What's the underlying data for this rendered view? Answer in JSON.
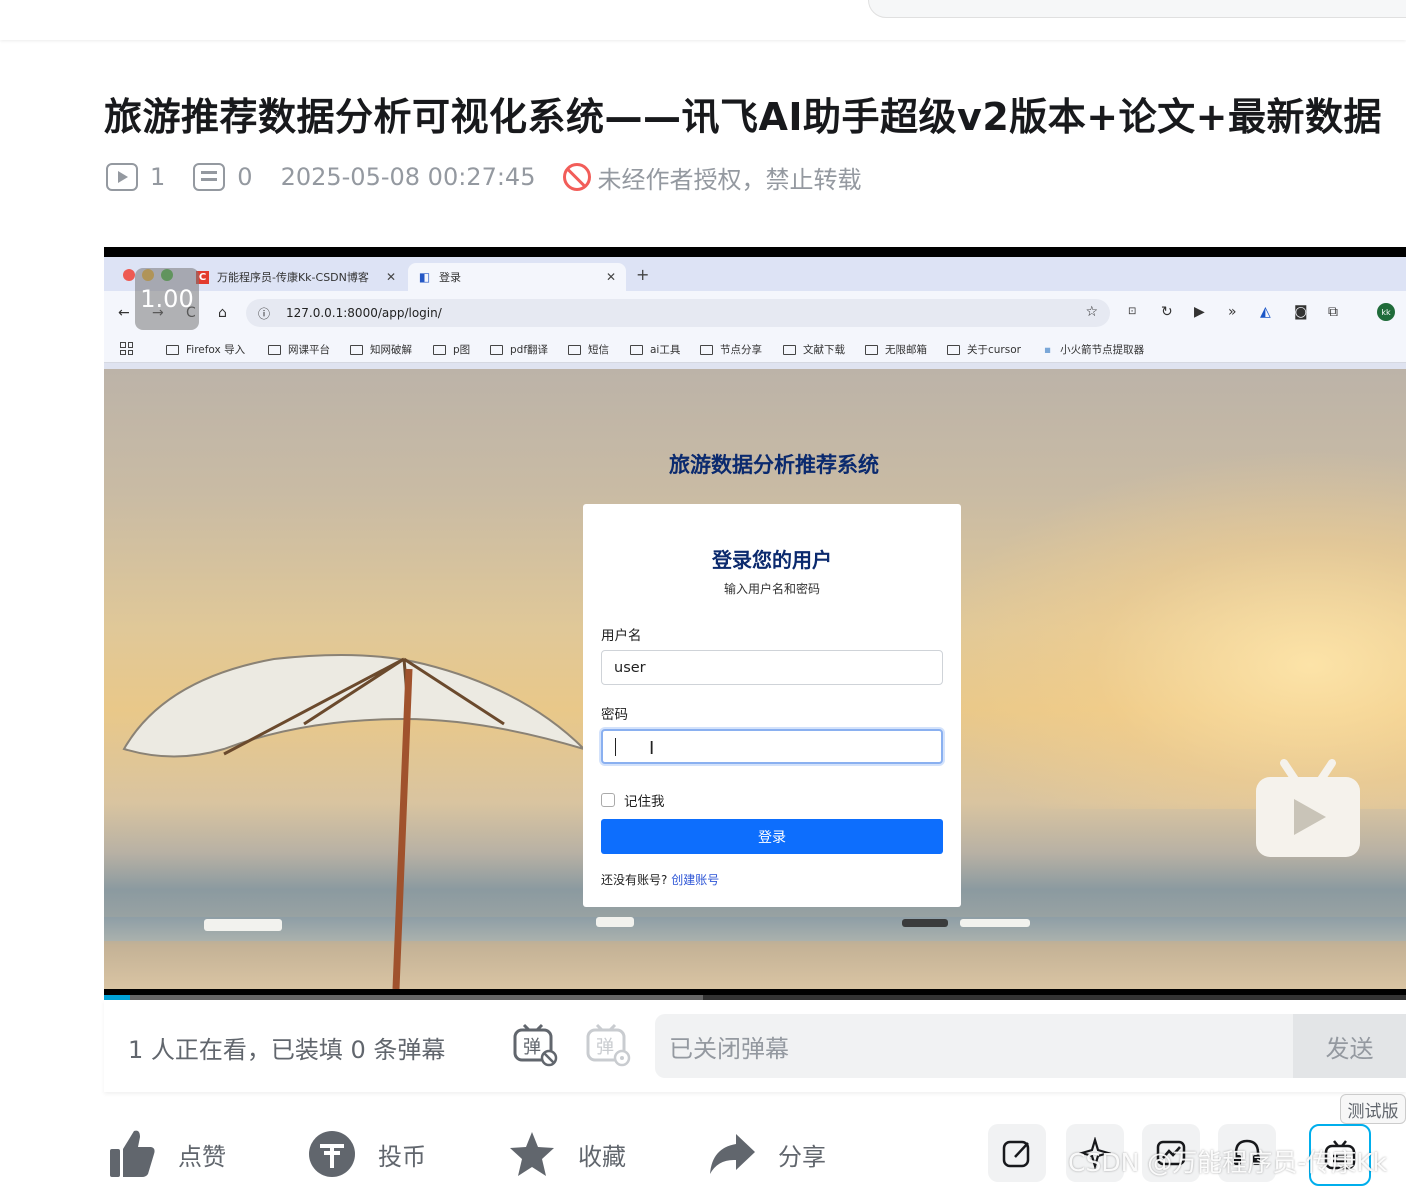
{
  "page": {
    "title": "旅游推荐数据分析可视化系统——讯飞AI助手超级v2版本+论文+最新数据",
    "meta": {
      "plays": "1",
      "danmaku_count": "0",
      "date": "2025-05-08 00:27:45",
      "copyright": "未经作者授权，禁止转载"
    }
  },
  "player": {
    "speed": "1.00",
    "progress_played": 0.02,
    "progress_loaded": 0.46
  },
  "browser": {
    "tabs": [
      {
        "label": "万能程序员-传康Kk-CSDN博客",
        "active": false
      },
      {
        "label": "登录",
        "active": true
      }
    ],
    "url": "127.0.0.1:8000/app/login/",
    "bookmarks": [
      "Firefox 导入",
      "网课平台",
      "知网破解",
      "p图",
      "pdf翻译",
      "短信",
      "ai工具",
      "节点分享",
      "文献下载",
      "无限邮箱",
      "关于cursor",
      "小火箭节点提取器"
    ],
    "profile": "kk"
  },
  "login": {
    "app_title": "旅游数据分析推荐系统",
    "card_title": "登录您的用户",
    "card_subtitle": "输入用户名和密码",
    "username_label": "用户名",
    "username_value": "user",
    "password_label": "密码",
    "password_value": "",
    "remember_label": "记住我",
    "submit_label": "登录",
    "no_account": "还没有账号?",
    "create_account": "创建账号"
  },
  "danmaku_bar": {
    "watching": "1 人正在看，已装填 0 条弹幕",
    "input_placeholder": "已关闭弹幕",
    "send_label": "发送"
  },
  "actions": {
    "like": "点赞",
    "coin": "投币",
    "favorite": "收藏",
    "share": "分享",
    "badge": "测试版"
  },
  "watermark": "CSDN @万能程序员-传康Kk",
  "colors": {
    "accent": "#00aeec",
    "login_button": "#0d6efd",
    "heading_navy": "#0b2a6e",
    "ban_red": "#f25d59"
  }
}
